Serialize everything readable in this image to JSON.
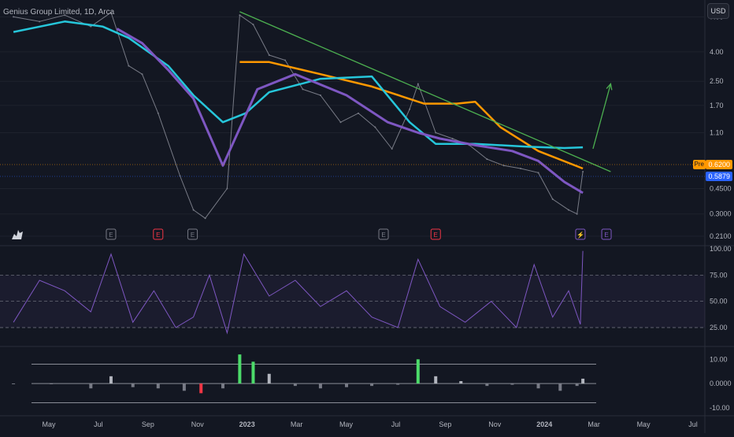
{
  "header": {
    "title": "Genius Group Limited, 1D, Arca",
    "currency_button": "USD",
    "pre_label": "Pre"
  },
  "price_tags": {
    "pre_price": "0.6200",
    "last_price": "0.5879",
    "pre_color": "#ff9800",
    "last_color": "#2962ff"
  },
  "colors": {
    "background": "#131722",
    "trendline": "#4caf50",
    "ma_orange": "#ff9800",
    "ma_cyan": "#26c6da",
    "ma_purple": "#7e57c2",
    "rsi_line": "#7e57c2",
    "up_arrow": "#4caf50",
    "earnings_badge": "#787b86",
    "earnings_badge_red": "#f23645",
    "dividend_badge": "#7e57c2"
  },
  "x_axis": {
    "labels": [
      "May",
      "Jul",
      "Sep",
      "Nov",
      "2023",
      "Mar",
      "May",
      "Jul",
      "Sep",
      "Nov",
      "2024",
      "Mar",
      "May",
      "Jul"
    ]
  },
  "event_markers": [
    {
      "date": "2022-08-25",
      "glyph": "E",
      "kind": "earnings-icon",
      "color": "#787b86"
    },
    {
      "date": "2022-10-20",
      "glyph": "E",
      "kind": "earnings-icon",
      "color": "#f23645"
    },
    {
      "date": "2022-11-30",
      "glyph": "E",
      "kind": "earnings-icon",
      "color": "#787b86"
    },
    {
      "date": "2023-07-15",
      "glyph": "E",
      "kind": "earnings-icon",
      "color": "#787b86"
    },
    {
      "date": "2023-09-15",
      "glyph": "E",
      "kind": "earnings-icon",
      "color": "#f23645"
    },
    {
      "date": "2024-03-05",
      "glyph": "⚡",
      "kind": "split-icon",
      "color": "#7e57c2"
    },
    {
      "date": "2024-04-05",
      "glyph": "E",
      "kind": "earnings-icon",
      "color": "#7e57c2"
    }
  ],
  "chart_data": [
    {
      "type": "line",
      "panel": "price",
      "title": "Genius Group Limited, 1D, Arca",
      "scale": "log",
      "x_domain": [
        "2022-04-15",
        "2024-07-31"
      ],
      "ylim": [
        0.19,
        8.5
      ],
      "y_ticks": [
        "7.00",
        "4.00",
        "2.50",
        "1.70",
        "1.10",
        "0.4500",
        "0.3000",
        "0.2100"
      ],
      "series": [
        {
          "role": "price",
          "color": "#787b86",
          "x": [
            "2022-05-01",
            "2022-06-01",
            "2022-07-01",
            "2022-08-01",
            "2022-08-25",
            "2022-09-15",
            "2022-10-01",
            "2022-10-20",
            "2022-11-15",
            "2022-12-01",
            "2022-12-15",
            "2023-01-10",
            "2023-01-25",
            "2023-02-10",
            "2023-03-01",
            "2023-03-20",
            "2023-04-10",
            "2023-05-01",
            "2023-05-25",
            "2023-06-15",
            "2023-07-05",
            "2023-07-25",
            "2023-08-15",
            "2023-08-25",
            "2023-09-15",
            "2023-10-05",
            "2023-10-25",
            "2023-11-15",
            "2023-12-05",
            "2023-12-25",
            "2024-01-15",
            "2024-02-01",
            "2024-02-20",
            "2024-03-01",
            "2024-03-08"
          ],
          "y": [
            7.0,
            6.5,
            7.2,
            6.0,
            7.5,
            3.2,
            2.8,
            1.5,
            0.55,
            0.32,
            0.28,
            0.45,
            7.2,
            6.2,
            3.8,
            3.5,
            2.2,
            2.0,
            1.3,
            1.5,
            1.2,
            0.85,
            1.6,
            2.4,
            1.1,
            1.0,
            0.9,
            0.72,
            0.65,
            0.62,
            0.58,
            0.38,
            0.32,
            0.3,
            0.59
          ]
        },
        {
          "role": "moving-average",
          "color": "#ff9800",
          "x": [
            "2023-01-25",
            "2023-03-01",
            "2023-05-01",
            "2023-07-01",
            "2023-09-01",
            "2023-10-10",
            "2023-11-01",
            "2023-12-01",
            "2024-01-15",
            "2024-03-08"
          ],
          "y": [
            3.4,
            3.4,
            2.8,
            2.3,
            1.75,
            1.75,
            1.8,
            1.2,
            0.82,
            0.62
          ]
        },
        {
          "role": "moving-average",
          "color": "#26c6da",
          "x": [
            "2022-05-01",
            "2022-07-01",
            "2022-08-15",
            "2022-09-15",
            "2022-11-01",
            "2022-12-01",
            "2023-01-05",
            "2023-02-01",
            "2023-03-01",
            "2023-05-01",
            "2023-07-01",
            "2023-08-15",
            "2023-09-15",
            "2023-11-01",
            "2024-01-01",
            "2024-02-15",
            "2024-03-08"
          ],
          "y": [
            5.5,
            6.5,
            6.0,
            5.0,
            3.2,
            2.0,
            1.3,
            1.5,
            2.1,
            2.6,
            2.7,
            1.3,
            0.92,
            0.92,
            0.88,
            0.86,
            0.87
          ]
        },
        {
          "role": "moving-average",
          "color": "#7e57c2",
          "x": [
            "2022-09-01",
            "2022-10-01",
            "2022-11-01",
            "2022-12-01",
            "2023-01-05",
            "2023-02-15",
            "2023-04-01",
            "2023-06-01",
            "2023-07-20",
            "2023-08-25",
            "2023-09-20",
            "2023-11-01",
            "2023-12-15",
            "2024-01-15",
            "2024-02-15",
            "2024-03-08"
          ],
          "y": [
            5.8,
            4.6,
            3.0,
            1.9,
            0.65,
            2.2,
            2.8,
            2.0,
            1.3,
            1.1,
            1.0,
            0.9,
            0.82,
            0.7,
            0.5,
            0.42
          ]
        }
      ],
      "annotations": [
        {
          "kind": "trendline",
          "color": "#4caf50",
          "x": [
            "2023-01-25",
            "2024-04-10"
          ],
          "y": [
            7.6,
            0.59
          ]
        },
        {
          "kind": "arrow-up",
          "color": "#4caf50",
          "x": [
            "2024-03-20",
            "2024-04-10"
          ],
          "y": [
            0.85,
            2.4
          ]
        }
      ]
    },
    {
      "type": "line",
      "panel": "rsi",
      "ylim": [
        10,
        100
      ],
      "y_ticks": [
        "100.00",
        "75.00",
        "50.00",
        "25.00"
      ],
      "band": [
        25,
        75
      ],
      "series": [
        {
          "role": "rsi",
          "color": "#7e57c2",
          "x": [
            "2022-05-01",
            "2022-06-01",
            "2022-07-01",
            "2022-08-01",
            "2022-08-25",
            "2022-09-20",
            "2022-10-15",
            "2022-11-10",
            "2022-12-01",
            "2022-12-20",
            "2023-01-10",
            "2023-01-30",
            "2023-03-01",
            "2023-04-01",
            "2023-05-01",
            "2023-06-01",
            "2023-07-01",
            "2023-08-01",
            "2023-08-25",
            "2023-09-20",
            "2023-10-20",
            "2023-11-20",
            "2023-12-20",
            "2024-01-10",
            "2024-02-01",
            "2024-02-20",
            "2024-03-05",
            "2024-03-08"
          ],
          "y": [
            30,
            70,
            60,
            40,
            95,
            30,
            60,
            25,
            35,
            75,
            20,
            95,
            55,
            70,
            45,
            60,
            35,
            25,
            90,
            45,
            30,
            50,
            25,
            85,
            35,
            60,
            28,
            98
          ]
        }
      ]
    },
    {
      "type": "bar",
      "panel": "histogram",
      "ylim": [
        -12,
        14
      ],
      "y_ticks": [
        "10.00",
        "0.0000",
        "-10.00"
      ],
      "reference_lines": [
        8,
        0,
        -8
      ],
      "x": [
        "2022-05-01",
        "2022-06-15",
        "2022-08-01",
        "2022-08-25",
        "2022-09-20",
        "2022-10-20",
        "2022-11-20",
        "2022-12-10",
        "2023-01-05",
        "2023-01-25",
        "2023-02-10",
        "2023-03-01",
        "2023-04-01",
        "2023-05-01",
        "2023-06-01",
        "2023-07-01",
        "2023-08-01",
        "2023-08-25",
        "2023-09-15",
        "2023-10-15",
        "2023-11-15",
        "2023-12-15",
        "2024-01-15",
        "2024-02-10",
        "2024-03-01",
        "2024-03-08"
      ],
      "values": [
        0,
        0,
        -2,
        3,
        -1.5,
        -2,
        -3,
        -4,
        -2,
        12,
        9,
        4,
        -1,
        -2,
        -1.5,
        -1,
        -0.5,
        10,
        3,
        1,
        -1,
        -0.5,
        -2,
        -3,
        -1,
        2
      ],
      "positive_color": "#b2b5be",
      "strong_positive_color": "#4cdb6a",
      "negative_color": "#787b86",
      "strong_negative_color": "#f23645"
    }
  ]
}
